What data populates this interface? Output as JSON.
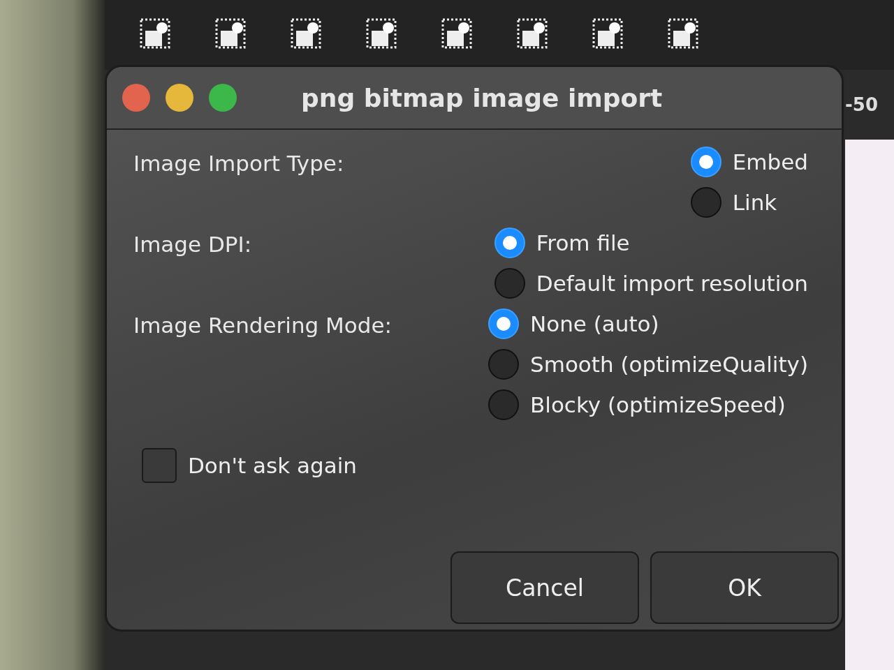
{
  "ruler": {
    "label": "-50"
  },
  "dialog": {
    "title": "png bitmap image import",
    "groups": [
      {
        "label": "Image Import Type:",
        "options": [
          {
            "label": "Embed",
            "selected": true
          },
          {
            "label": "Link",
            "selected": false
          }
        ]
      },
      {
        "label": "Image DPI:",
        "options": [
          {
            "label": "From file",
            "selected": true
          },
          {
            "label": "Default import resolution",
            "selected": false
          }
        ]
      },
      {
        "label": "Image Rendering Mode:",
        "options": [
          {
            "label": "None (auto)",
            "selected": true
          },
          {
            "label": "Smooth (optimizeQuality)",
            "selected": false
          },
          {
            "label": "Blocky (optimizeSpeed)",
            "selected": false
          }
        ]
      }
    ],
    "checkbox": {
      "label": "Don't ask again",
      "checked": false
    },
    "buttons": [
      "Cancel",
      "OK"
    ]
  }
}
